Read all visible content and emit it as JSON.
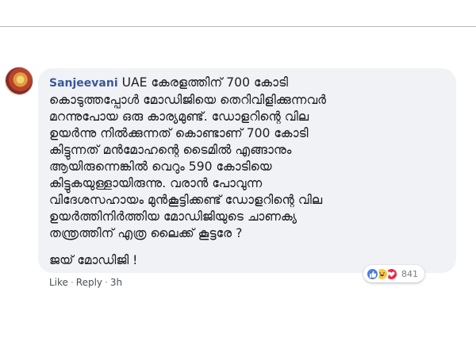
{
  "comment": {
    "author": "Sanjeevani",
    "first_line_text": " UAE കേരളത്തിന് 700 കോടി",
    "lines": [
      "കൊടുത്തപ്പോൾ മോഡിജിയെ തെറിവിളിക്കുന്നവർ",
      "മറന്നുപോയ ഒരു കാര്യമുണ്ട്. ഡോളറിന്റെ വില",
      "ഉയർന്നു നിൽക്കുന്നത് കൊണ്ടാണ് 700 കോടി",
      "കിട്ടുന്നത് മൻമോഹന്റെ ടൈമിൽ എങ്ങാനും",
      "ആയിരുന്നെങ്കിൽ വെറും 590 കോടിയെ",
      "കിട്ടുകയുള്ളായിരുന്നു. വരാൻ പോവുന്ന",
      "വിദേശസഹായം മുൻകൂട്ടിക്കണ്ട് ഡോളറിന്റെ വില",
      "ഉയർത്തിനിർത്തിയ മോഡിജിയുടെ ചാണക്യ",
      "തന്ത്രത്തിന് എത്ര ലൈക്ക് കൂട്ടരേ ?"
    ],
    "closing": "ജയ് മോഡിജി !"
  },
  "reactions": {
    "icons": [
      "like-icon",
      "haha-icon",
      "love-icon"
    ],
    "count": "841"
  },
  "actions": {
    "like": "Like",
    "separator": "·",
    "reply": "Reply",
    "time": "3h"
  },
  "colors": {
    "author": "#385898",
    "bubble": "#f1f2f6",
    "like": "#4a7ee2",
    "haha": "#f7c948",
    "love": "#f0284a"
  }
}
